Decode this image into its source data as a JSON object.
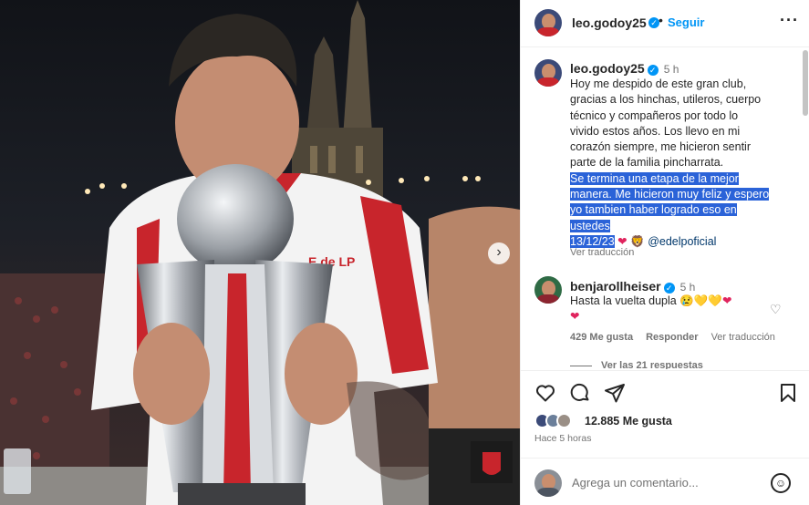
{
  "post": {
    "username": "leo.godoy25",
    "follow_label": "Seguir",
    "dot": "•",
    "more_label": "···",
    "carousel_next": "›",
    "jersey_text": "E de LP"
  },
  "caption": {
    "username": "leo.godoy25",
    "time": "5 h",
    "line_1": "Hoy me despido de este gran club,",
    "line_2": "gracias a los hinchas, utileros, cuerpo",
    "line_3": "técnico y compañeros por todo lo",
    "line_4": "vivido estos años. Los llevo en mi",
    "line_5": "corazón siempre, me hicieron sentir",
    "line_6": "parte de la familia pincharrata.",
    "sel_1": "Se termina una etapa de la mejor",
    "sel_2": "manera. Me hicieron muy feliz y espero",
    "sel_3": "yo tambien haber logrado eso en",
    "sel_4": "ustedes",
    "date": "13/12/23",
    "heart": "❤",
    "lion": "🦁",
    "mention": "@edelpoficial",
    "translate": "Ver traducción"
  },
  "comment": {
    "username": "benjarollheiser",
    "time": "5 h",
    "text": "Hasta la vuelta dupla",
    "emoji_1": "😢",
    "emoji_2": "💛",
    "emoji_3": "💛",
    "emoji_4": "❤",
    "emoji_5": "❤",
    "likes": "429 Me gusta",
    "reply": "Responder",
    "translate": "Ver traducción",
    "like_icon": "♡",
    "view_replies": "Ver las 21 respuestas"
  },
  "actions": {
    "likes": "12.885 Me gusta",
    "posted": "Hace 5 horas",
    "icons": [
      "heart-icon",
      "comment-icon",
      "share-icon",
      "bookmark-icon"
    ]
  },
  "add_comment": {
    "placeholder": "Agrega un comentario...",
    "emoji_icon": "☺"
  },
  "colors": {
    "accent": "#0095f6",
    "selection": "#2b63d8",
    "mention": "#00376b",
    "muted": "#737373",
    "jersey_red": "#c8252c"
  }
}
